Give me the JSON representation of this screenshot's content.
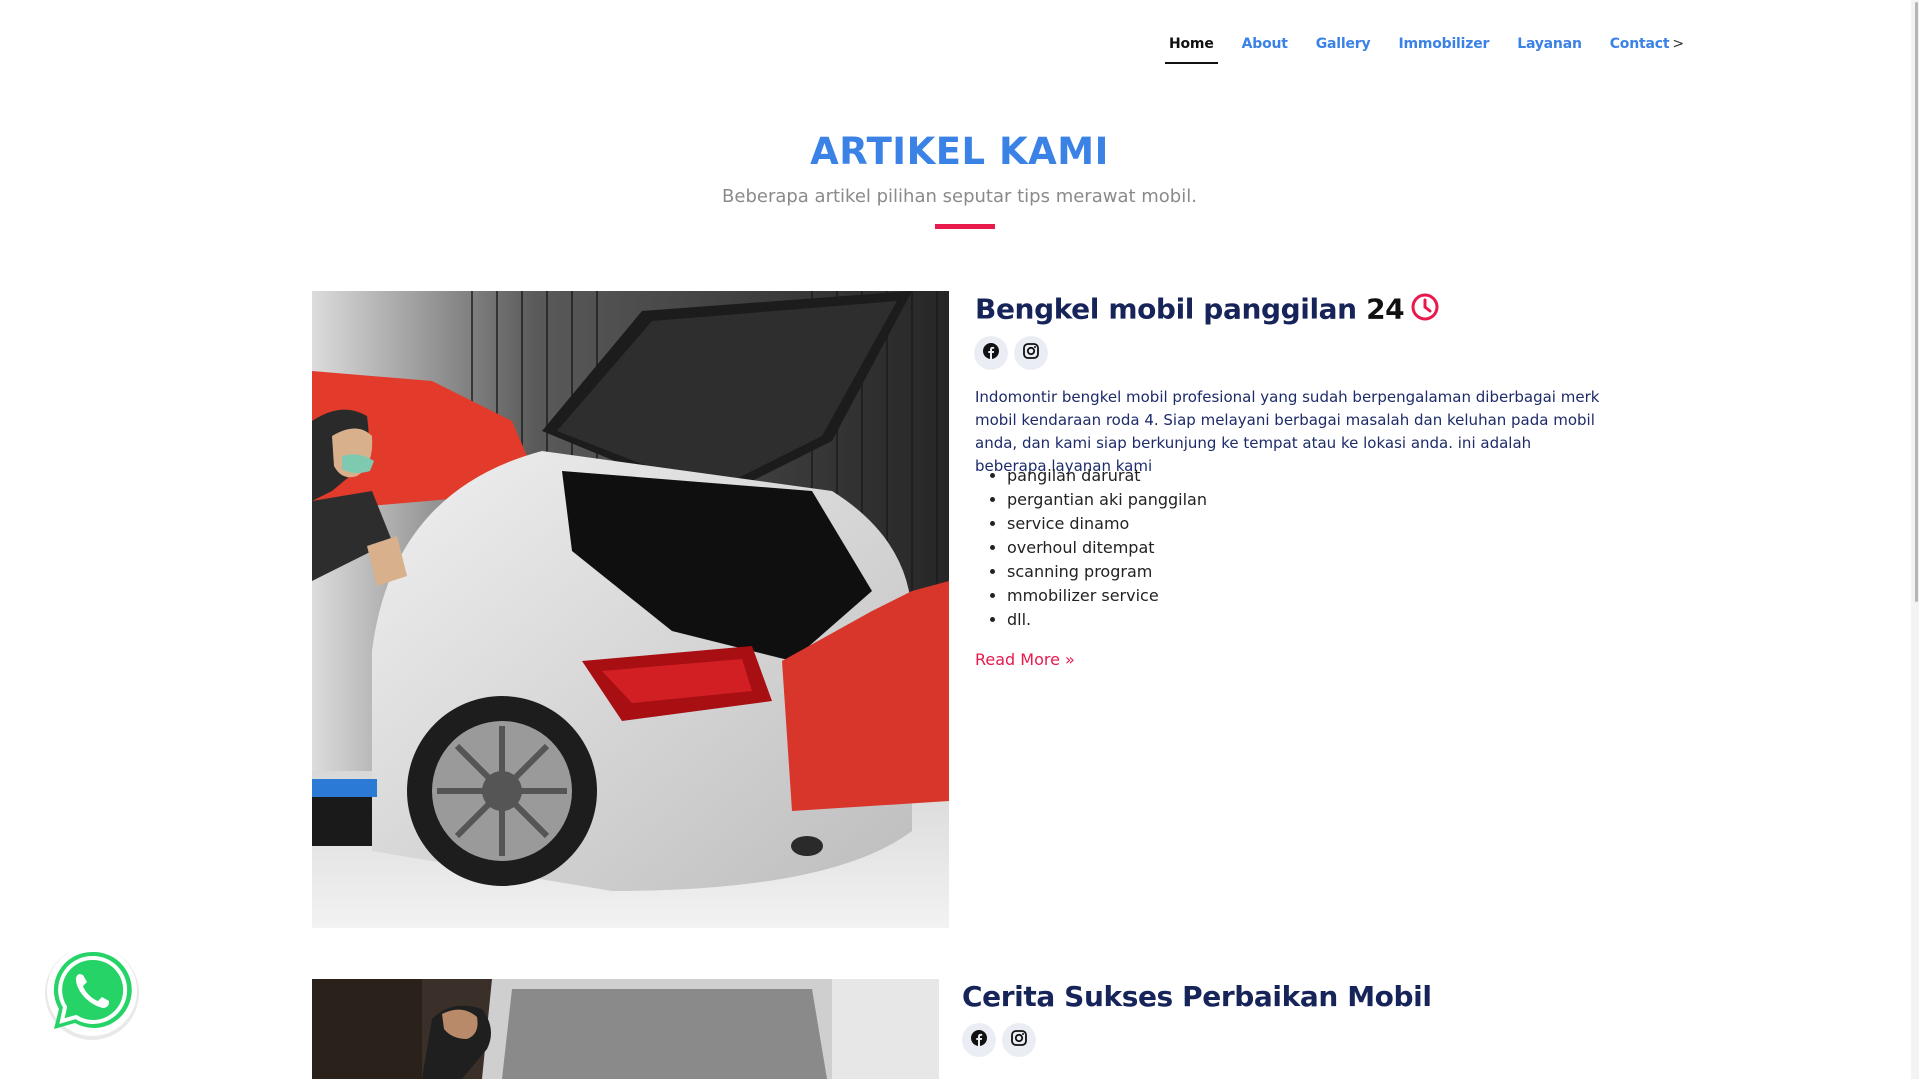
{
  "nav": {
    "items": [
      {
        "label": "Home"
      },
      {
        "label": "About"
      },
      {
        "label": "Gallery"
      },
      {
        "label": "Immobilizer"
      },
      {
        "label": "Layanan"
      },
      {
        "label": "Contact"
      }
    ],
    "contact_caret": ">"
  },
  "section": {
    "title": "ARTIKEL KAMI",
    "subtitle": "Beberapa artikel pilihan seputar tips merawat mobil."
  },
  "articles": [
    {
      "title": "Bengkel mobil panggilan",
      "title_number": "24",
      "body": "Indomontir bengkel mobil profesional yang sudah berpengalaman diberbagai merk mobil kendaraan roda 4. Siap melayani berbagai masalah dan keluhan pada mobil anda, dan kami siap berkunjung ke tempat atau ke lokasi anda. ini adalah beberapa layanan kami",
      "list": [
        "pangilan darurat",
        "pergantian aki panggilan",
        "service dinamo",
        "overhoul ditempat",
        "scanning program",
        "mmobilizer service",
        "dll."
      ],
      "read_more": "Read More »"
    },
    {
      "title": "Cerita Sukses Perbaikan Mobil"
    }
  ],
  "icons": {
    "facebook": "facebook-icon",
    "instagram": "instagram-icon",
    "clock": "clock-icon",
    "whatsapp": "whatsapp-icon"
  },
  "colors": {
    "accent_blue": "#3b82e6",
    "title_navy": "#16245a",
    "accent_red": "#e8194b",
    "whatsapp_green": "#25d366"
  }
}
